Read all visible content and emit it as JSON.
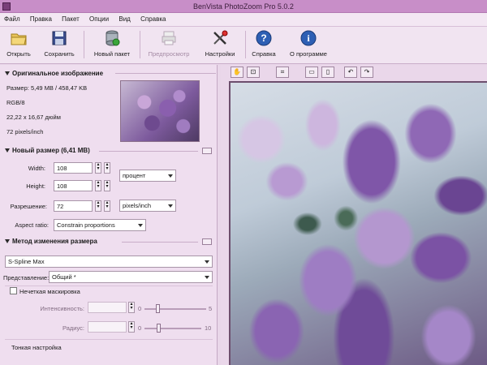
{
  "window": {
    "title": "BenVista PhotoZoom Pro 5.0.2"
  },
  "menu": [
    "Файл",
    "Правка",
    "Пакет",
    "Опции",
    "Вид",
    "Справка"
  ],
  "toolbar": {
    "open": "Открыть",
    "save": "Сохранить",
    "batch": "Новый пакет",
    "preview": "Предпросмотр",
    "settings": "Настройки",
    "help": "Справка",
    "about": "О программе"
  },
  "original": {
    "header": "Оригинальное изображение",
    "size": "Размер: 5,49 MB / 458,47 KB",
    "mode": "RGB/8",
    "dims": "22,22 x 16,67 дюйм",
    "res": "72 pixels/inch"
  },
  "newsize": {
    "header": "Новый размер (6,41 MB)",
    "width_label": "Width:",
    "width_value": "108",
    "height_label": "Height:",
    "height_value": "108",
    "unit": "процент",
    "res_label": "Разрешение:",
    "res_value": "72",
    "res_unit": "pixels/inch",
    "aspect_label": "Aspect ratio:",
    "aspect_value": "Constrain proportions"
  },
  "method": {
    "header": "Метод изменения размера",
    "algorithm": "S-Spline Max",
    "preset_label": "Представление:",
    "preset_value": "Общий *"
  },
  "unsharp": {
    "label": "Нечеткая маскировка",
    "intensity_label": "Интенсивность:",
    "intensity_min": "0",
    "intensity_max": "5",
    "radius_label": "Радиус:",
    "radius_min": "0",
    "radius_max": "10"
  },
  "fine": {
    "label": "Тонкая настройка"
  }
}
